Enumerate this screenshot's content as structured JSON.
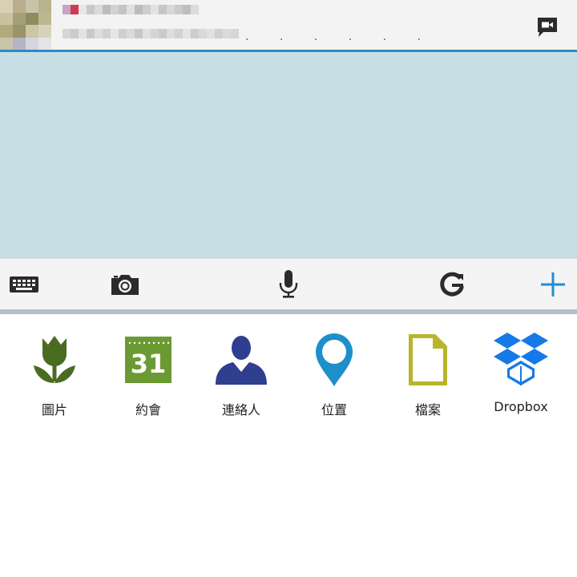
{
  "header": {
    "dots": ". . . . . ."
  },
  "colors": {
    "header_bg": "#f3f3f3",
    "accent": "#2b8cc4",
    "chat_bg": "#c8dee5",
    "toolbar_bg": "#f4f4f4",
    "icon_dark": "#2b2b2b",
    "plus_blue": "#1f8fd0",
    "pictures_green": "#4a6b22",
    "calendar_green": "#6b9a33",
    "contacts_navy": "#2f3e8f",
    "location_blue": "#1e8fc9",
    "files_olive": "#b8b52c",
    "dropbox_blue": "#1679e8"
  },
  "toolbar": {
    "icons": [
      "keyboard-icon",
      "camera-icon",
      "microphone-icon",
      "google-icon",
      "plus-icon"
    ]
  },
  "attachments": {
    "items": [
      {
        "label": "圖片",
        "icon": "tulip-icon"
      },
      {
        "label": "約會",
        "icon": "calendar-icon",
        "calendar_day": "31"
      },
      {
        "label": "連絡人",
        "icon": "person-icon"
      },
      {
        "label": "位置",
        "icon": "map-pin-icon"
      },
      {
        "label": "檔案",
        "icon": "document-icon"
      },
      {
        "label": "Dropbox",
        "icon": "dropbox-icon"
      }
    ]
  }
}
